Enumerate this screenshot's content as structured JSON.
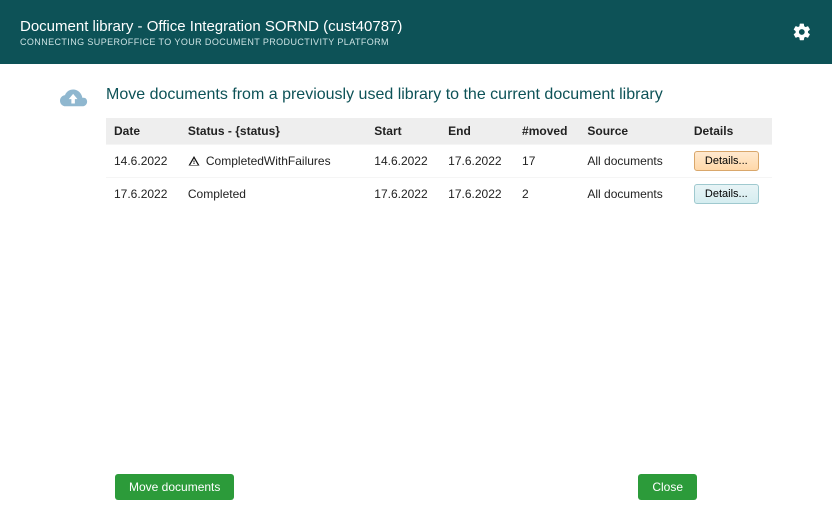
{
  "header": {
    "title": "Document library - Office Integration SORND (cust40787)",
    "subtitle": "CONNECTING SUPEROFFICE TO YOUR DOCUMENT PRODUCTIVITY PLATFORM"
  },
  "section": {
    "title": "Move documents from a previously used library to the current document library"
  },
  "table": {
    "headers": {
      "date": "Date",
      "status": "Status - {status}",
      "start": "Start",
      "end": "End",
      "moved": "#moved",
      "source": "Source",
      "details": "Details"
    },
    "rows": [
      {
        "date": "14.6.2022",
        "status": "CompletedWithFailures",
        "statusWarn": true,
        "start": "14.6.2022",
        "end": "17.6.2022",
        "moved": "17",
        "source": "All documents",
        "detailsLabel": "Details...",
        "detailsClass": "warn"
      },
      {
        "date": "17.6.2022",
        "status": "Completed",
        "statusWarn": false,
        "start": "17.6.2022",
        "end": "17.6.2022",
        "moved": "2",
        "source": "All documents",
        "detailsLabel": "Details...",
        "detailsClass": "ok"
      }
    ]
  },
  "footer": {
    "move": "Move documents",
    "close": "Close"
  }
}
